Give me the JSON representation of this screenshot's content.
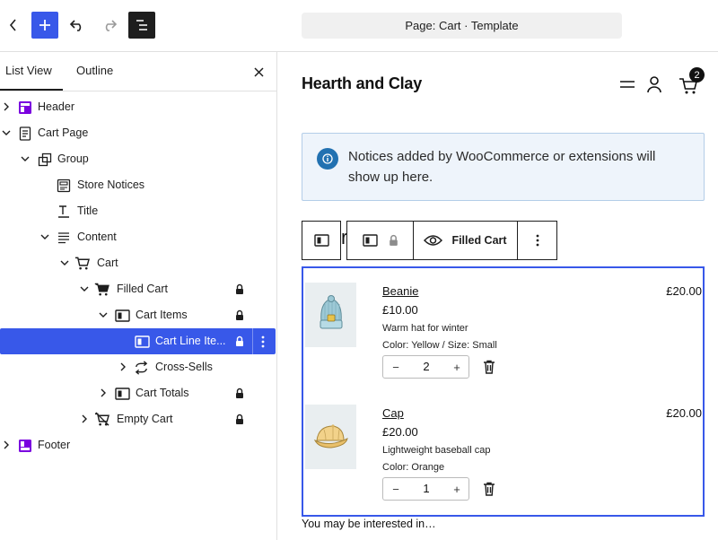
{
  "toolbar": {
    "document_title": "Page: Cart · Template"
  },
  "sidebar": {
    "tabs": [
      "List View",
      "Outline"
    ],
    "tree": [
      {
        "label": "Header",
        "icon": "template-part-icon",
        "locked": false
      },
      {
        "label": "Cart Page",
        "icon": "page-icon",
        "locked": false
      },
      {
        "label": "Group",
        "icon": "group-icon",
        "locked": false
      },
      {
        "label": "Store Notices",
        "icon": "store-notices-icon",
        "locked": false
      },
      {
        "label": "Title",
        "icon": "title-icon",
        "locked": false
      },
      {
        "label": "Content",
        "icon": "content-icon",
        "locked": false
      },
      {
        "label": "Cart",
        "icon": "cart-icon",
        "locked": false
      },
      {
        "label": "Filled Cart",
        "icon": "filled-cart-icon",
        "locked": true
      },
      {
        "label": "Cart Items",
        "icon": "columns-icon",
        "locked": true
      },
      {
        "label": "Cart Line Ite...",
        "icon": "columns-icon",
        "locked": true
      },
      {
        "label": "Cross-Sells",
        "icon": "cross-sells-icon",
        "locked": false
      },
      {
        "label": "Cart Totals",
        "icon": "columns-icon",
        "locked": true
      },
      {
        "label": "Empty Cart",
        "icon": "empty-cart-icon",
        "locked": true
      },
      {
        "label": "Footer",
        "icon": "template-part-icon",
        "locked": false
      }
    ]
  },
  "canvas": {
    "site_title": "Hearth and Clay",
    "cart_count": "2",
    "notice": "Notices added by WooCommerce or extensions will show up here.",
    "block_toolbar": {
      "peek_char": "r",
      "view_label": "Filled Cart"
    },
    "items": [
      {
        "name": "Beanie",
        "price": "£10.00",
        "description": "Warm hat for winter",
        "meta": "Color: Yellow / Size: Small",
        "quantity": "2",
        "total": "£20.00",
        "minus": "−",
        "plus": "+"
      },
      {
        "name": "Cap",
        "price": "£20.00",
        "description": "Lightweight baseball cap",
        "meta": "Color: Orange",
        "quantity": "1",
        "total": "£20.00",
        "minus": "−",
        "plus": "+"
      }
    ],
    "cross_sells_heading": "You may be interested in…"
  },
  "colors": {
    "accent": "#3858e9",
    "dark": "#1e1e1e",
    "notice_bg": "#eef4fb",
    "notice_icon": "#2271b1",
    "template_part": "#7a00df"
  }
}
